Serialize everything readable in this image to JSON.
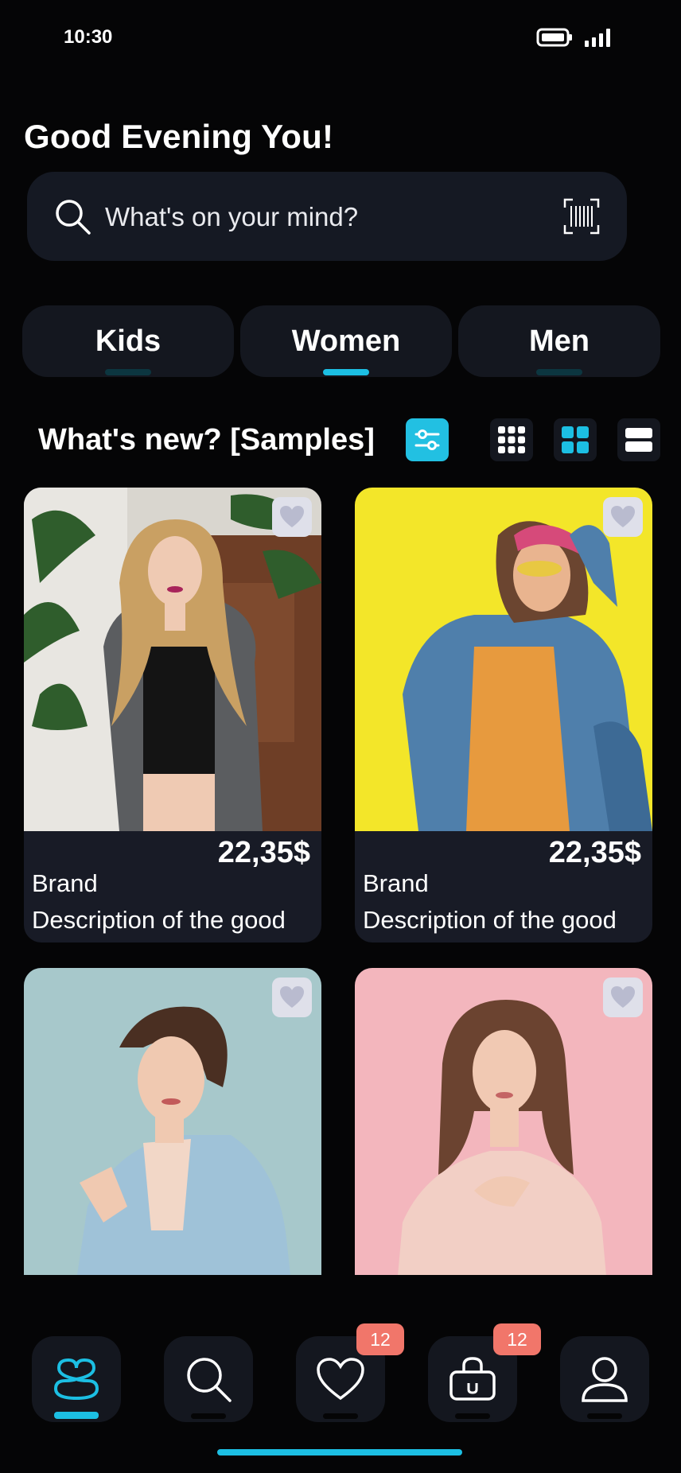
{
  "status_bar": {
    "time": "10:30"
  },
  "header": {
    "greeting": "Good Evening You!"
  },
  "search": {
    "placeholder": "What's on your mind?"
  },
  "tabs": [
    {
      "label": "Kids",
      "active": false
    },
    {
      "label": "Women",
      "active": true
    },
    {
      "label": "Men",
      "active": false
    }
  ],
  "section": {
    "title": "What's new? [Samples]"
  },
  "products": [
    {
      "price": "22,35$",
      "brand": "Brand",
      "description": "Description of the good",
      "photo": "woman-long-blond-hair-black-top"
    },
    {
      "price": "22,35$",
      "brand": "Brand",
      "description": "Description of the good",
      "photo": "woman-denim-jacket-yellow-wall"
    },
    {
      "price": "",
      "brand": "",
      "description": "",
      "photo": "woman-light-blue-blazer"
    },
    {
      "price": "",
      "brand": "",
      "description": "",
      "photo": "woman-pink-blouse-pink-wall"
    }
  ],
  "bottom_nav": {
    "items": [
      {
        "name": "home",
        "icon": "logo-icon",
        "active": true
      },
      {
        "name": "search",
        "icon": "search-icon"
      },
      {
        "name": "favorites",
        "icon": "heart-icon",
        "badge": "12"
      },
      {
        "name": "cart",
        "icon": "shopping-bag-icon",
        "badge": "12"
      },
      {
        "name": "profile",
        "icon": "user-icon"
      }
    ]
  },
  "colors": {
    "accent": "#1cbfe3",
    "badge": "#f1766a",
    "surface": "#14171f",
    "background": "#050506"
  }
}
